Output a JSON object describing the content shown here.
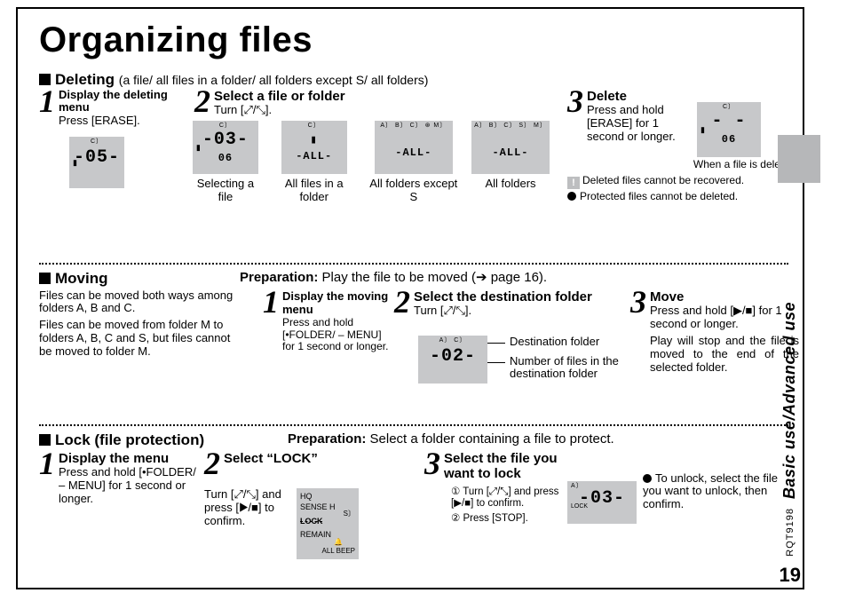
{
  "title": "Organizing files",
  "sidebar": {
    "tab": "Basic use/Advanced use",
    "rqt": "RQT9198",
    "page": "19"
  },
  "deleting": {
    "heading": "Deleting",
    "sub": "(a file/ all files in a folder/ all folders except S/ all folders)",
    "step1": {
      "num": "1",
      "t": "Display the deleting menu",
      "body": "Press [ERASE]."
    },
    "step2": {
      "num": "2",
      "t": "Select a file or folder",
      "body": "Turn [⤢/⤡].",
      "caps": [
        "Selecting a file",
        "All files in a folder",
        "All folders except  S",
        "All folders"
      ],
      "lcd": [
        {
          "top": "C〕",
          "main": "-03-",
          "sub": "06",
          "side": "▮"
        },
        {
          "top": "C〕",
          "main": "▮",
          "sub": "-ALL-"
        },
        {
          "top": "A〕 B〕 C〕 ⊛ M〕",
          "main": "",
          "sub": "-ALL-"
        },
        {
          "top": "A〕 B〕 C〕 S〕 M〕",
          "main": "",
          "sub": "-ALL-"
        }
      ]
    },
    "step3": {
      "num": "3",
      "t": "Delete",
      "body": "Press and hold [ERASE] for 1 second or longer.",
      "lcd": {
        "top": "C〕",
        "main": "- -",
        "sub": "06",
        "side": "▮"
      },
      "caption": "When a file is deleted.",
      "warn1": "Deleted files cannot be recovered.",
      "warn2": "Protected files cannot be deleted."
    },
    "s1_lcd": {
      "top": "C〕",
      "main": "-05-",
      "side": "▮"
    }
  },
  "moving": {
    "heading": "Moving",
    "intro1": "Files can be moved both ways among folders A, B and C.",
    "intro2": "Files can be moved from folder M to folders A, B, C and S, but files cannot be moved to folder M.",
    "prep_label": "Preparation:",
    "prep_body": "Play the file to be moved (➔ page 16).",
    "step1": {
      "num": "1",
      "t": "Display the moving menu",
      "body": "Press and hold [•FOLDER/ – MENU] for 1 second or longer."
    },
    "step2": {
      "num": "2",
      "t": "Select the destination folder",
      "body": "Turn [⤢/⤡].",
      "note1": "Destination folder",
      "note2": "Number of files in the destination folder",
      "lcd": {
        "top": "A〕         C〕",
        "main": "-02-"
      }
    },
    "step3": {
      "num": "3",
      "t": "Move",
      "body1": "Press and hold [▶/■] for 1 second or longer.",
      "body2": "Play will stop and the file is moved to the end of the selected folder."
    }
  },
  "lock": {
    "heading": "Lock (file protection)",
    "prep_label": "Preparation:",
    "prep_body": "Select a folder containing a file to protect.",
    "step1": {
      "num": "1",
      "t": "Display the menu",
      "body": "Press and hold [•FOLDER/ – MENU] for 1 second or longer."
    },
    "step2": {
      "num": "2",
      "t": "Select “LOCK”",
      "body": "Turn [⤢/⤡] and press [▶/■] to confirm.",
      "lcd_lines": [
        "HQ",
        "SENSE H",
        "LOCK",
        "REMAIN"
      ],
      "sj": "S〕",
      "bicon": "ALL BEEP"
    },
    "step3": {
      "num": "3",
      "t": "Select the file you want to lock",
      "line1": "① Turn [⤢/⤡] and press [▶/■] to confirm.",
      "line2": "② Press [STOP].",
      "lcd": {
        "top": "A〕",
        "main": "-03-",
        "lock": "LOCK"
      }
    },
    "unlock": "To unlock, select the file you want to unlock, then confirm."
  }
}
